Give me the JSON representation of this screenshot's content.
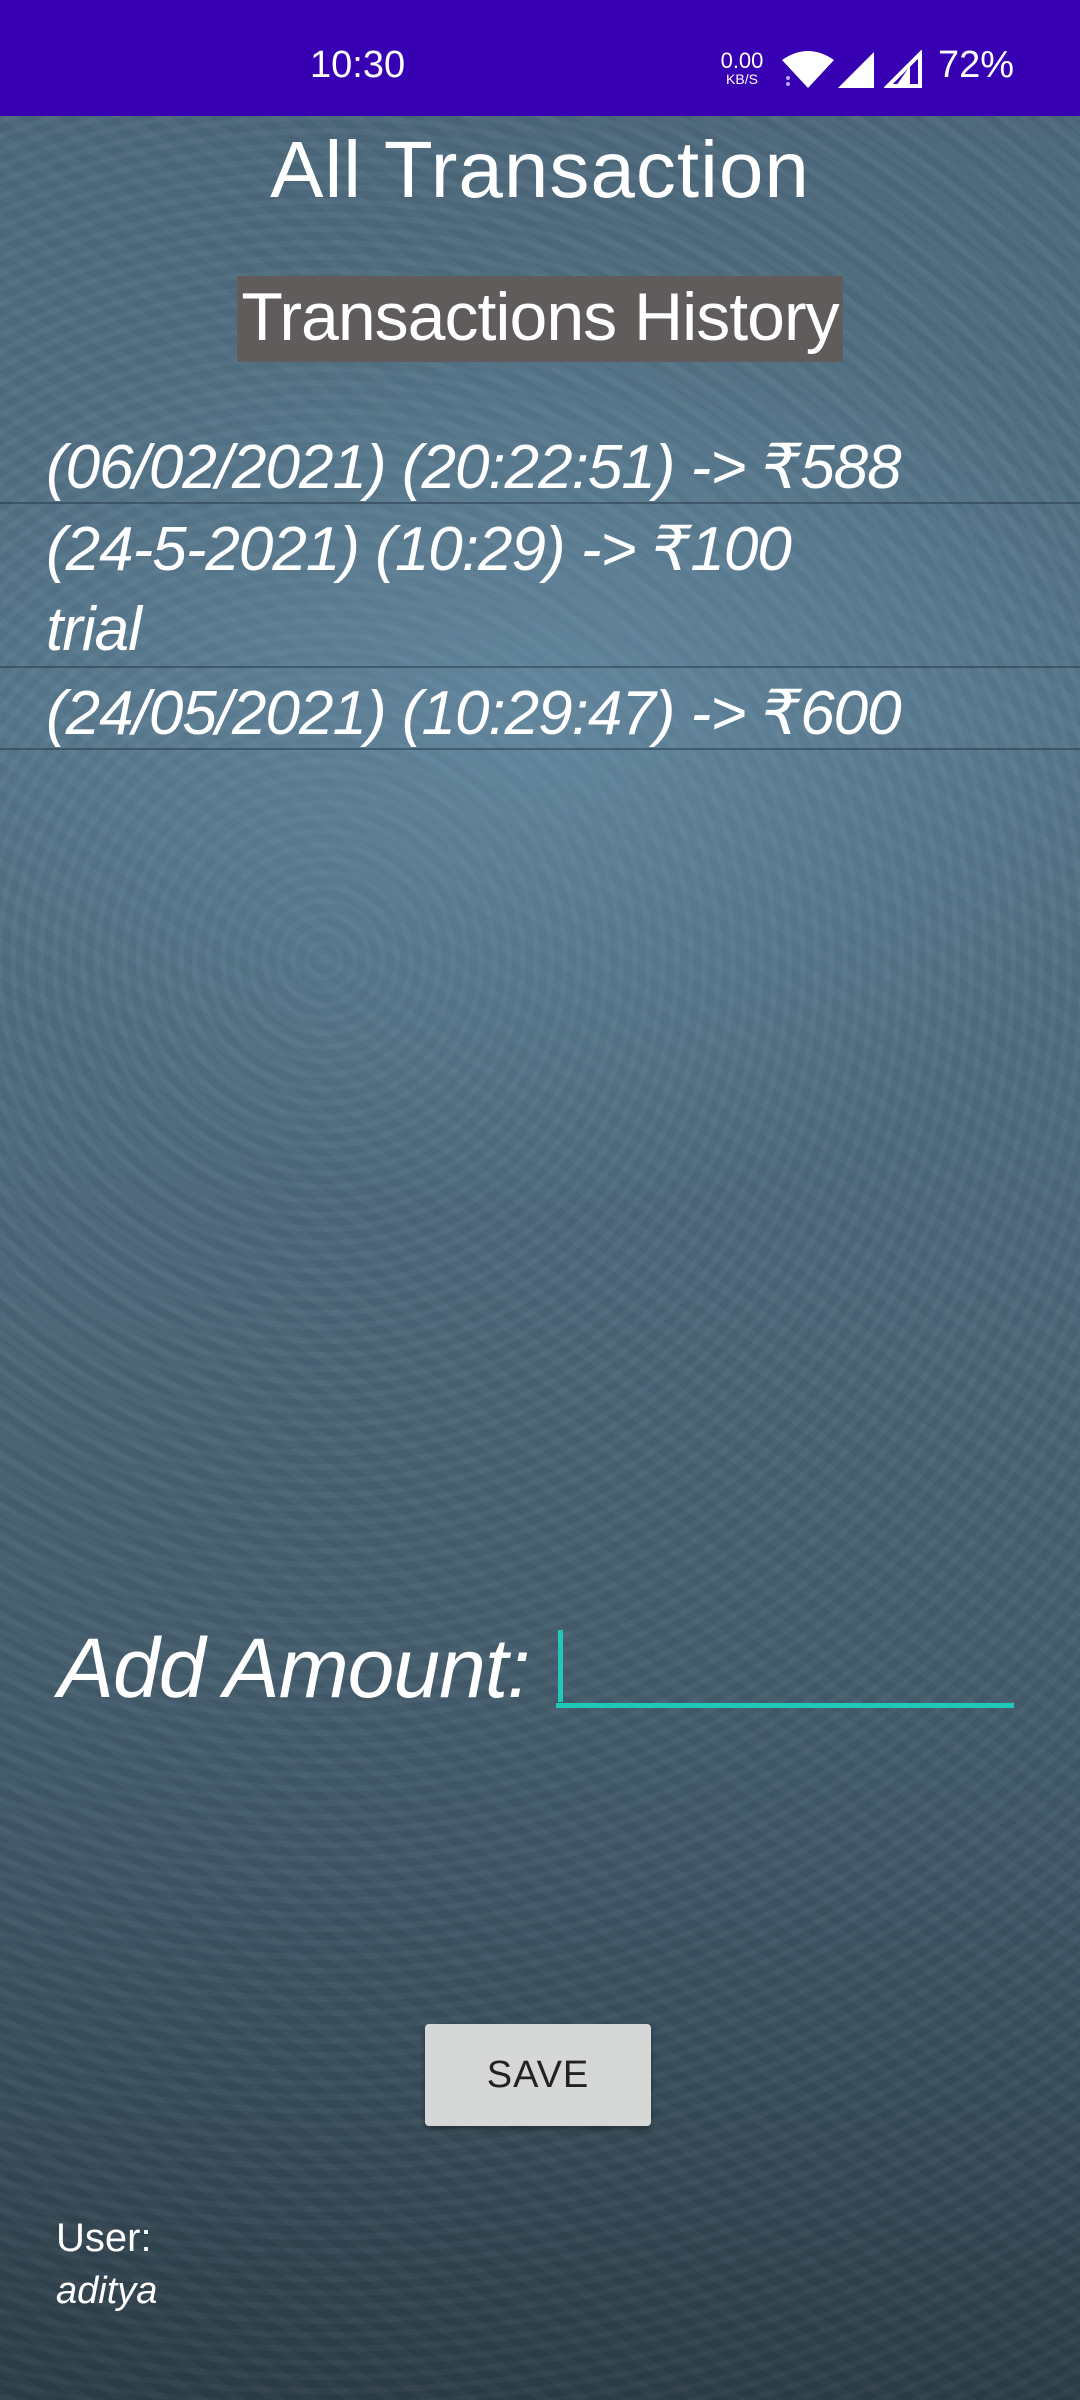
{
  "status_bar": {
    "time": "10:30",
    "net_speed_value": "0.00",
    "net_speed_unit": "KB/S",
    "battery": "72%",
    "background_color": "#3700b3",
    "icons": [
      "wifi-icon",
      "signal-icon",
      "signal-icon-secondary"
    ]
  },
  "header": {
    "title": "All  Transaction",
    "history_heading": "Transactions History"
  },
  "transactions": [
    "(06/02/2021) (20:22:51) -> ₹588",
    "(24-5-2021) (10:29) -> ₹100",
    "trial",
    "(24/05/2021) (10:29:47) -> ₹600"
  ],
  "form": {
    "add_amount_label": "Add Amount:",
    "amount_value": "",
    "save_label": "SAVE",
    "accent_color": "#1ec9b7"
  },
  "user": {
    "label": "User:",
    "name": "aditya"
  }
}
